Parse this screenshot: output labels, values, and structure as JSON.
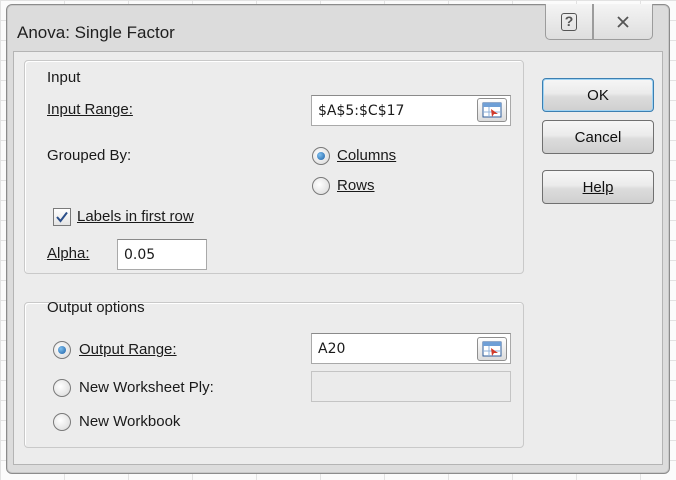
{
  "dialog": {
    "title": "Anova: Single Factor",
    "help_title_icon": "question-icon",
    "close_title_icon": "close-icon"
  },
  "input_group": {
    "label": "Input",
    "input_range_label": "Input Range:",
    "input_range_value": "$A$5:$C$17",
    "grouped_by_label": "Grouped By:",
    "columns_label": "Columns",
    "rows_label": "Rows",
    "grouped_by_selected": "Columns",
    "labels_first_row_label": "Labels in first row",
    "labels_first_row_checked": true,
    "alpha_label": "Alpha:",
    "alpha_value": "0.05"
  },
  "output_group": {
    "label": "Output options",
    "output_range_label": "Output Range:",
    "output_range_value": "A20",
    "new_worksheet_label": "New Worksheet Ply:",
    "new_worksheet_value": "",
    "new_workbook_label": "New Workbook",
    "selected": "Output Range"
  },
  "buttons": {
    "ok": "OK",
    "cancel": "Cancel",
    "help": "Help"
  },
  "colors": {
    "dialog_bg": "#dcdcdc",
    "client_bg": "#ececec",
    "default_button_border": "#3c7fb1",
    "radio_selected": "#1c5fa6"
  }
}
